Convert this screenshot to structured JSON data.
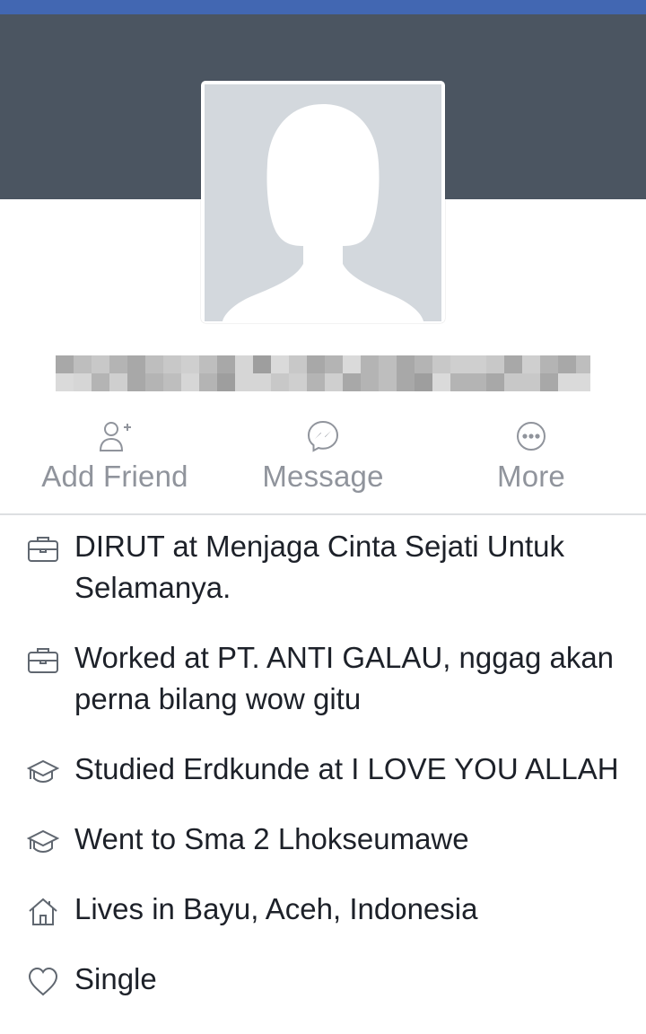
{
  "colors": {
    "topbar": "#4267b2",
    "cover": "#4b5561",
    "avatar_bg": "#d3d8dd",
    "action_text": "#90949c"
  },
  "profile": {
    "avatar_icon": "female-silhouette-icon",
    "name_pixelated": true
  },
  "actions": [
    {
      "label": "Add Friend",
      "icon": "add-friend-icon"
    },
    {
      "label": "Message",
      "icon": "messenger-icon"
    },
    {
      "label": "More",
      "icon": "more-dots-icon"
    }
  ],
  "info": [
    {
      "text": "DIRUT at Menjaga Cinta Sejati Untuk Selamanya.",
      "icon": "briefcase-icon"
    },
    {
      "text": "Worked at PT. ANTI GALAU, nggag akan perna bilang wow gitu",
      "icon": "briefcase-icon"
    },
    {
      "text": "Studied Erdkunde at I LOVE YOU ALLAH",
      "icon": "graduation-cap-icon"
    },
    {
      "text": "Went to Sma 2 Lhokseumawe",
      "icon": "graduation-cap-icon"
    },
    {
      "text": "Lives in Bayu, Aceh, Indonesia",
      "icon": "home-icon"
    },
    {
      "text": "Single",
      "icon": "heart-icon"
    }
  ]
}
